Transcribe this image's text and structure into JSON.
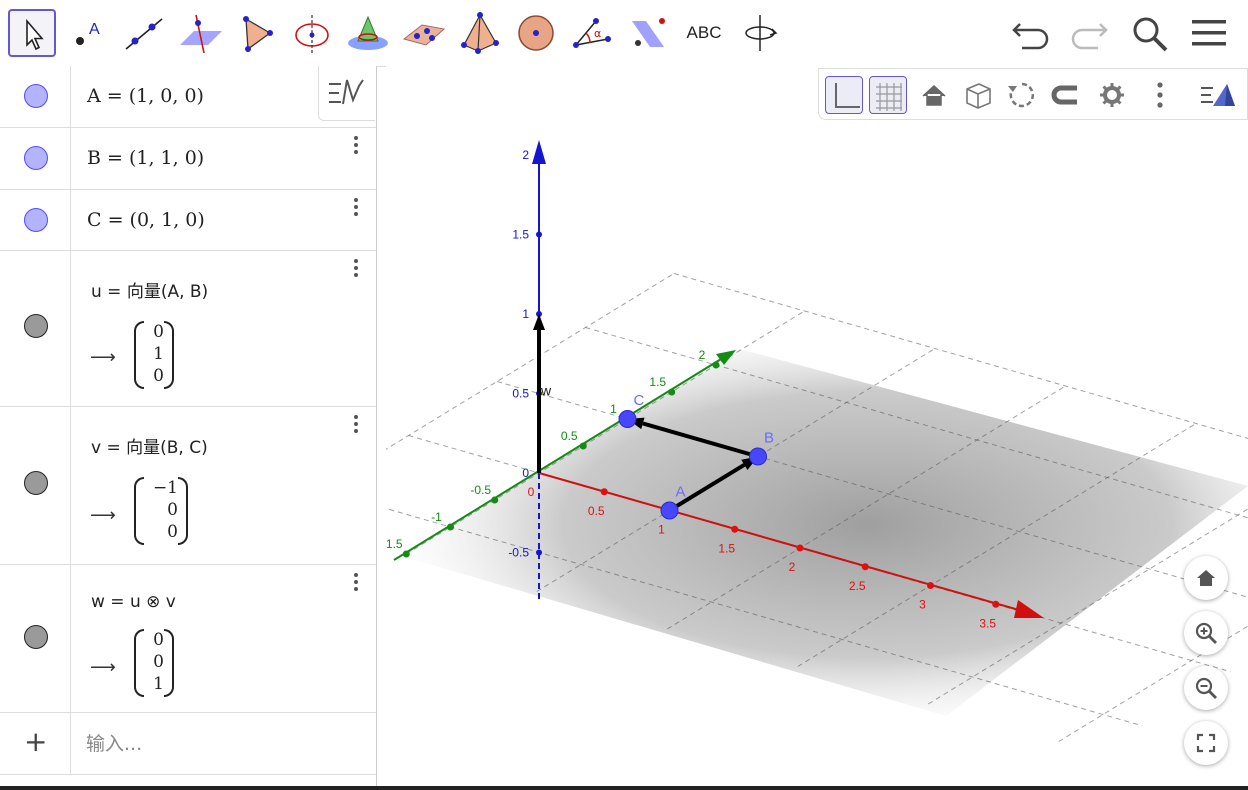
{
  "toolbar": {
    "tools": [
      {
        "name": "move-tool-icon",
        "selected": true
      },
      {
        "name": "point-tool-icon"
      },
      {
        "name": "line-tool-icon"
      },
      {
        "name": "perpendicular-line-tool-icon"
      },
      {
        "name": "polygon-tool-icon"
      },
      {
        "name": "circle-axis-tool-icon"
      },
      {
        "name": "intersect-surfaces-tool-icon"
      },
      {
        "name": "plane-through-points-tool-icon"
      },
      {
        "name": "pyramid-tool-icon"
      },
      {
        "name": "sphere-tool-icon"
      },
      {
        "name": "angle-tool-icon"
      },
      {
        "name": "reflect-tool-icon"
      },
      {
        "name": "text-tool-icon",
        "label": "ABC"
      },
      {
        "name": "rotate-view-tool-icon"
      }
    ],
    "undo": "undo-icon",
    "redo": "redo-icon",
    "search": "search-icon",
    "menu": "menu-icon"
  },
  "algebra": {
    "points": [
      {
        "id": "A",
        "formula": "A = (1, 0, 0)"
      },
      {
        "id": "B",
        "formula": "B = (1, 1, 0)"
      },
      {
        "id": "C",
        "formula": "C = (0, 1, 0)"
      }
    ],
    "vectors": [
      {
        "id": "u",
        "command": "u = 向量(A, B)",
        "result": [
          "0",
          "1",
          "0"
        ]
      },
      {
        "id": "v",
        "command": "v = 向量(B, C)",
        "result": [
          "−1",
          "0",
          "0"
        ]
      },
      {
        "id": "w",
        "command": "w = u ⊗ v",
        "result": [
          "0",
          "0",
          "1"
        ]
      }
    ],
    "arrow": "⟶",
    "input_placeholder": "输入...",
    "add_icon": "plus-icon"
  },
  "graphics_style_bar": {
    "buttons": [
      "axes-icon",
      "grid-icon",
      "home-icon",
      "view-cube-icon",
      "rotate-icon",
      "projection-icon",
      "settings-icon",
      "more-icon",
      "view-toggle-icon"
    ],
    "active": [
      "axes-icon",
      "grid-icon"
    ]
  },
  "graphics": {
    "x_axis_ticks": [
      "0",
      "0.5",
      "1",
      "1.5",
      "2",
      "2.5",
      "3",
      "3.5"
    ],
    "y_axis_ticks": [
      "-1.5",
      "-1",
      "-0.5",
      "0",
      "0.5",
      "1",
      "1.5",
      "2"
    ],
    "z_axis_ticks": [
      "-0.5",
      "0",
      "0.5",
      "1",
      "1.5",
      "2"
    ],
    "point_labels": [
      "A",
      "B",
      "C"
    ],
    "vector_label": "w",
    "points": [
      {
        "label": "A",
        "x": 1,
        "y": 0,
        "z": 0
      },
      {
        "label": "B",
        "x": 1,
        "y": 1,
        "z": 0
      },
      {
        "label": "C",
        "x": 0,
        "y": 1,
        "z": 0
      }
    ],
    "vectors": [
      {
        "name": "u",
        "from": "A",
        "to": "B"
      },
      {
        "name": "v",
        "from": "B",
        "to": "C"
      },
      {
        "name": "w",
        "from": "O",
        "to": [
          0,
          0,
          1
        ]
      }
    ],
    "colors": {
      "x_axis": "#e01010",
      "y_axis": "#158a15",
      "z_axis": "#1515d0",
      "point": "#4747ff",
      "vector": "#000000",
      "plane": "#b8b8b8"
    }
  },
  "zoom_buttons": [
    "home-icon",
    "zoom-in-icon",
    "zoom-out-icon",
    "fullscreen-icon"
  ]
}
